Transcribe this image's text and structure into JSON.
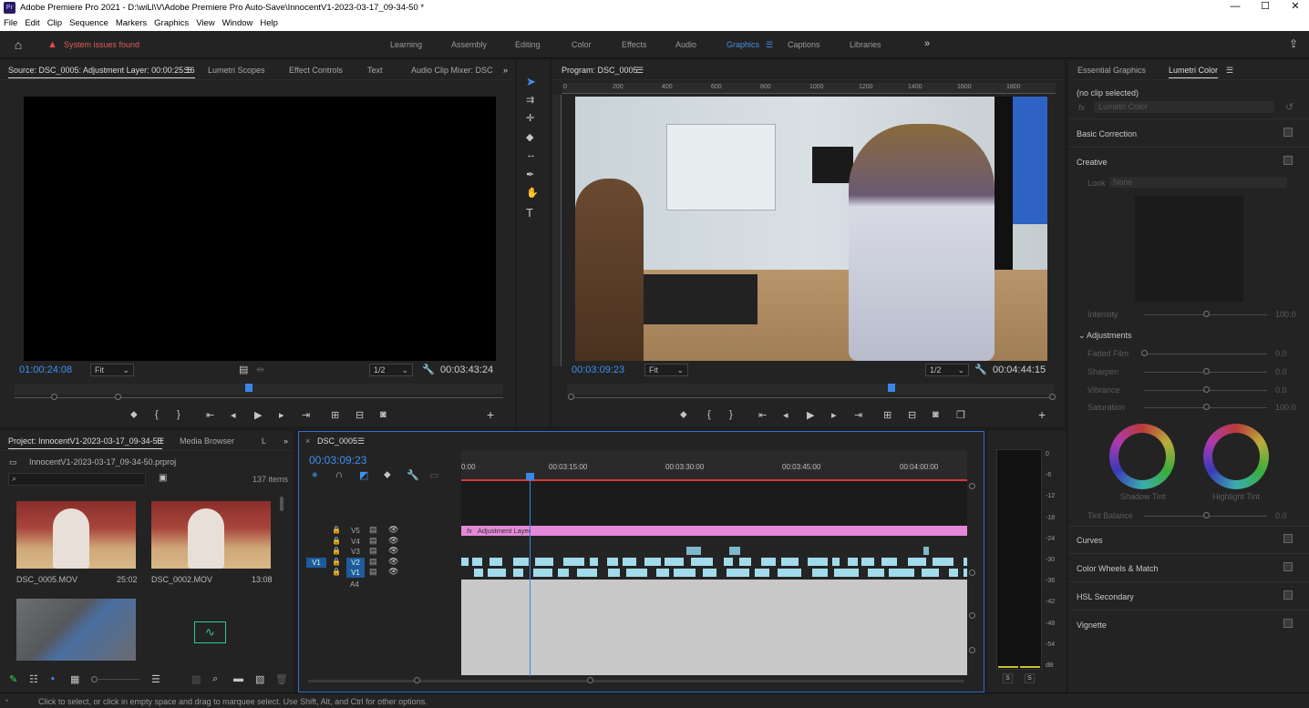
{
  "titlebar": {
    "logo": "Pr",
    "title": "Adobe Premiere Pro 2021 - D:\\wiLl\\V\\Adobe Premiere Pro Auto-Save\\InnocentV1-2023-03-17_09-34-50 *",
    "minimize": "—",
    "maximize": "☐",
    "close": "✕"
  },
  "menu": [
    "File",
    "Edit",
    "Clip",
    "Sequence",
    "Markers",
    "Graphics",
    "View",
    "Window",
    "Help"
  ],
  "workbar": {
    "alert": "System issues found",
    "workspaces": [
      "Learning",
      "Assembly",
      "Editing",
      "Color",
      "Effects",
      "Audio",
      "Graphics",
      "Captions",
      "Libraries"
    ],
    "active": "Graphics",
    "more": "»"
  },
  "source": {
    "tabs": [
      "Source: DSC_0005: Adjustment Layer: 00:00:25:16",
      "Lumetri Scopes",
      "Effect Controls",
      "Text",
      "Audio Clip Mixer: DSC"
    ],
    "timecode": "01:00:24:08",
    "fit": "Fit",
    "res": "1/2",
    "duration": "00:03:43:24",
    "playhead": 0.48
  },
  "program": {
    "tab": "Program: DSC_0005",
    "timecode": "00:03:09:23",
    "fit": "Fit",
    "res": "1/2",
    "duration": "00:04:44:15",
    "ruler": [
      "0",
      "200",
      "400",
      "600",
      "800",
      "1000",
      "1200",
      "1400",
      "1600",
      "1800"
    ],
    "playhead": 0.67
  },
  "tools": [
    "selection-tool",
    "track-select-tool",
    "ripple-edit-tool",
    "razor-tool",
    "slip-tool",
    "pen-tool",
    "hand-tool",
    "type-tool"
  ],
  "project": {
    "tabs": [
      "Project: InnocentV1-2023-03-17_09-34-50",
      "Media Browser",
      "L"
    ],
    "file": "InnocentV1-2023-03-17_09-34-50.prproj",
    "count": "137 items",
    "items": [
      {
        "name": "DSC_0005.MOV",
        "dur": "25:02"
      },
      {
        "name": "DSC_0002.MOV",
        "dur": "13:08"
      }
    ]
  },
  "timeline": {
    "tab": "DSC_0005",
    "timecode": "00:03:09:23",
    "times": [
      "0:00",
      "00:03:15:00",
      "00:03:30:00",
      "00:03:45:00",
      "00:04:00:00"
    ],
    "tracks": [
      "V5",
      "V4",
      "V3",
      "V2",
      "V1",
      "A4"
    ],
    "src_v1": "V1",
    "adjustment": "Adjustment Layer",
    "fx": "fx"
  },
  "meter": {
    "scale": [
      "0",
      "-6",
      "-12",
      "-18",
      "-24",
      "-30",
      "-36",
      "-42",
      "-48",
      "-54",
      "dB"
    ],
    "solo": [
      "S",
      "S"
    ]
  },
  "lumetri": {
    "tabs": [
      "Essential Graphics",
      "Lumetri Color"
    ],
    "noclip": "(no clip selected)",
    "fx": "fx",
    "effect": "Lumetri Color",
    "sections": [
      "Basic Correction",
      "Creative",
      "Curves",
      "Color Wheels & Match",
      "HSL Secondary",
      "Vignette"
    ],
    "look_label": "Look",
    "look": "None",
    "intensity": {
      "label": "Intensity",
      "value": "100.0",
      "level": 0.5
    },
    "adjustments": "Adjustments",
    "sliders": [
      {
        "label": "Faded Film",
        "value": "0.0",
        "level": 0
      },
      {
        "label": "Sharpen",
        "value": "0.0",
        "level": 0.5
      },
      {
        "label": "Vibrance",
        "value": "0.0",
        "level": 0.5
      },
      {
        "label": "Saturation",
        "value": "100.0",
        "level": 0.5
      }
    ],
    "wheels": [
      "Shadow Tint",
      "Highlight Tint"
    ],
    "tint": {
      "label": "Tint Balance",
      "value": "0.0",
      "level": 0.5
    }
  },
  "status": "Click to select, or click in empty space and drag to marquee select. Use Shift, Alt, and Ctrl for other options."
}
